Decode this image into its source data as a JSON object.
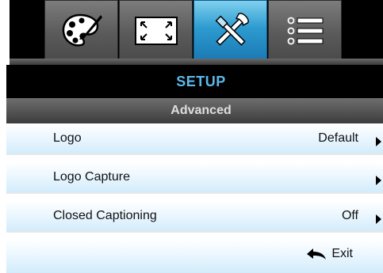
{
  "tabs": [
    {
      "icon": "palette-icon",
      "active": false
    },
    {
      "icon": "screen-resize-icon",
      "active": false
    },
    {
      "icon": "tools-icon",
      "active": true
    },
    {
      "icon": "list-icon",
      "active": false
    }
  ],
  "header": {
    "title": "SETUP",
    "title_color": "#5bb8ea"
  },
  "subheader": {
    "title": "Advanced"
  },
  "menu": {
    "items": [
      {
        "label": "Logo",
        "value": "Default"
      },
      {
        "label": "Logo Capture",
        "value": ""
      },
      {
        "label": "Closed Captioning",
        "value": "Off"
      }
    ]
  },
  "exit": {
    "label": "Exit",
    "icon": "back-arrow-icon"
  },
  "colors": {
    "accent": "#2d9bd0",
    "row_top": "#ffffff",
    "row_bottom": "#d2ecfb"
  }
}
